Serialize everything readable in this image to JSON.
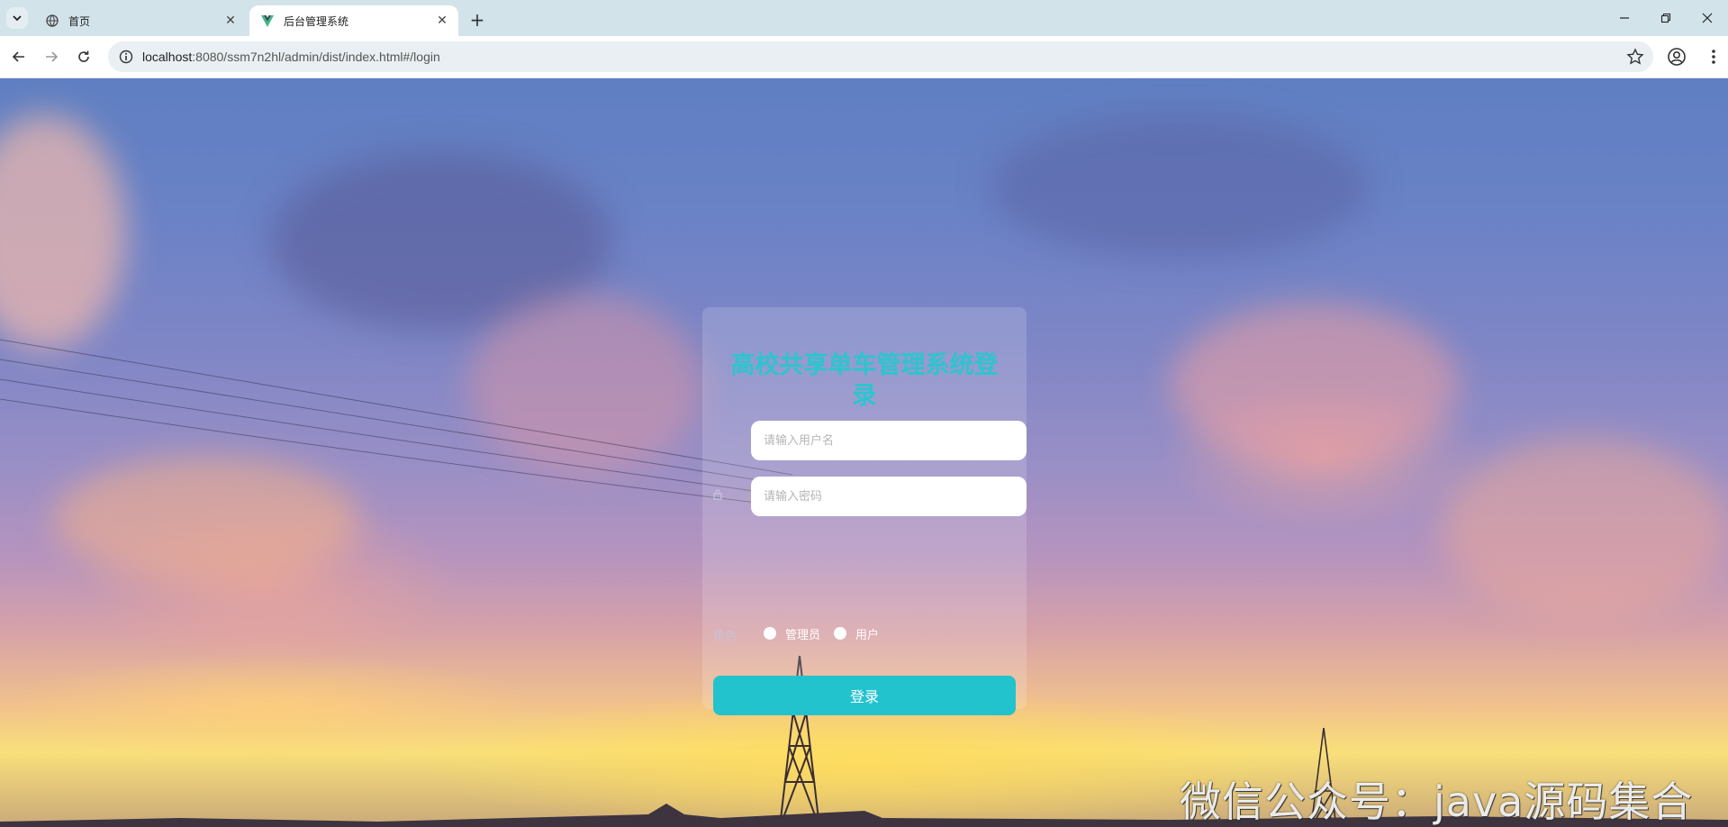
{
  "browser": {
    "tabs": [
      {
        "title": "首页",
        "icon": "globe-icon",
        "active": false
      },
      {
        "title": "后台管理系统",
        "icon": "vue-logo-icon",
        "active": true
      }
    ],
    "url_host": "localhost",
    "url_rest": ":8080/ssm7n2hl/admin/dist/index.html#/login"
  },
  "login": {
    "title": "高校共享单车管理系统登录",
    "username_placeholder": "请输入用户名",
    "password_placeholder": "请输入密码",
    "role_label": "角色",
    "roles": [
      "管理员",
      "用户"
    ],
    "submit_label": "登录"
  },
  "watermark": "微信公众号：java源码集合",
  "colors": {
    "title": "#2ec4cf",
    "button": "#22c3cd",
    "tabbar": "#d2e3ea"
  }
}
